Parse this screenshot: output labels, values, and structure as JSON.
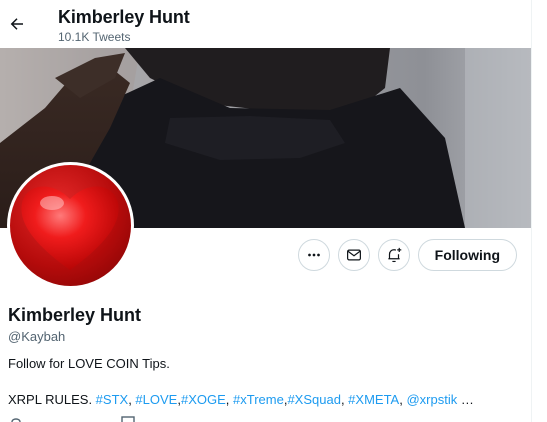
{
  "header": {
    "title": "Kimberley Hunt",
    "tweet_count": "10.1K Tweets"
  },
  "profile": {
    "name": "Kimberley Hunt",
    "handle": "@Kaybah",
    "bio_line1": "Follow for LOVE COIN Tips.",
    "bio_line2_prefix": "XRPL RULES. ",
    "bio_tags": [
      {
        "text": "#STX",
        "sep": ", "
      },
      {
        "text": "#LOVE",
        "sep": ","
      },
      {
        "text": "#XOGE",
        "sep": ", "
      },
      {
        "text": "#xTreme",
        "sep": ","
      },
      {
        "text": "#XSquad",
        "sep": ", "
      },
      {
        "text": "#XMETA",
        "sep": ", "
      },
      {
        "text": "@xrpstik",
        "sep": " …"
      }
    ]
  },
  "actions": {
    "more_icon": "more-icon",
    "message_icon": "envelope-icon",
    "notify_icon": "bell-plus-icon",
    "following_label": "Following"
  },
  "colors": {
    "link": "#1d9bf0",
    "text": "#0f1419",
    "secondary": "#536471",
    "border": "#cfd9de"
  }
}
